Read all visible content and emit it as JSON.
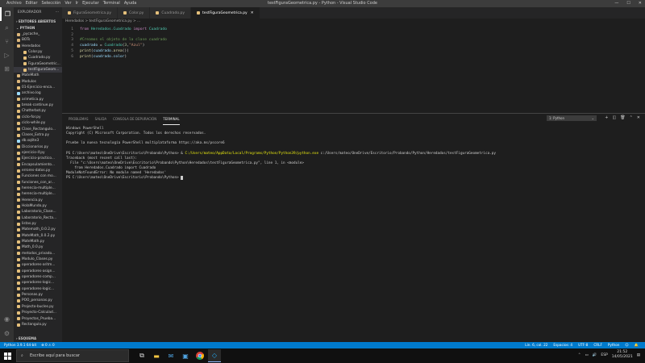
{
  "titlebar": {
    "menu": [
      "Archivo",
      "Editar",
      "Selección",
      "Ver",
      "Ir",
      "Ejecutar",
      "Terminal",
      "Ayuda"
    ],
    "title": "testFiguraGeometrica.py - Python - Visual Studio Code"
  },
  "sidebar": {
    "header": "EXPLORADOR",
    "open_editors": "EDITORES ABIERTOS",
    "root": "PYTHON",
    "items": [
      {
        "label": "_pycache_",
        "color": "#dcb67a",
        "indent": 4,
        "sel": false
      },
      {
        "label": "BOTs",
        "color": "#dcb67a",
        "indent": 4,
        "sel": false
      },
      {
        "label": "Heredados",
        "color": "#dcb67a",
        "indent": 4,
        "sel": false
      },
      {
        "label": "Color.py",
        "color": "#e5c07b",
        "indent": 12,
        "sel": false
      },
      {
        "label": "Cuadrado.py",
        "color": "#e5c07b",
        "indent": 12,
        "sel": false
      },
      {
        "label": "FiguraGeometric...",
        "color": "#e5c07b",
        "indent": 12,
        "sel": false
      },
      {
        "label": "testFiguraGeom...",
        "color": "#e5c07b",
        "indent": 12,
        "sel": true
      },
      {
        "label": "MateMath",
        "color": "#dcb67a",
        "indent": 4,
        "sel": false
      },
      {
        "label": "Modulos",
        "color": "#dcb67a",
        "indent": 4,
        "sel": false
      },
      {
        "label": "01-Ejercicio-enca...",
        "color": "#e5c07b",
        "indent": 4,
        "sel": false
      },
      {
        "label": "archivo.log",
        "color": "#9cdcfe",
        "indent": 4,
        "sel": false
      },
      {
        "label": "arimetica.py",
        "color": "#e5c07b",
        "indent": 4,
        "sel": false
      },
      {
        "label": "break-continue.py",
        "color": "#e5c07b",
        "indent": 4,
        "sel": false
      },
      {
        "label": "Chatterbot.py",
        "color": "#e5c07b",
        "indent": 4,
        "sel": false
      },
      {
        "label": "ciclo-for.py",
        "color": "#e5c07b",
        "indent": 4,
        "sel": false
      },
      {
        "label": "ciclo-while.py",
        "color": "#e5c07b",
        "indent": 4,
        "sel": false
      },
      {
        "label": "Clase_Rectangulo...",
        "color": "#e5c07b",
        "indent": 4,
        "sel": false
      },
      {
        "label": "Clases_Extra.py",
        "color": "#e5c07b",
        "indent": 4,
        "sel": false
      },
      {
        "label": "db.sqlite3",
        "color": "#9cdcfe",
        "indent": 4,
        "sel": false
      },
      {
        "label": "Diccionarios.py",
        "color": "#e5c07b",
        "indent": 4,
        "sel": false
      },
      {
        "label": "ejercicio-if.py",
        "color": "#e5c07b",
        "indent": 4,
        "sel": false
      },
      {
        "label": "Ejercicio-practico...",
        "color": "#e5c07b",
        "indent": 4,
        "sel": false
      },
      {
        "label": "Encapsulamiento...",
        "color": "#e5c07b",
        "indent": 4,
        "sel": false
      },
      {
        "label": "errores-datos.py",
        "color": "#e5c07b",
        "indent": 4,
        "sel": false
      },
      {
        "label": "Funciones con mo...",
        "color": "#e5c07b",
        "indent": 4,
        "sel": false
      },
      {
        "label": "funciones_con_ar...",
        "color": "#e5c07b",
        "indent": 4,
        "sel": false
      },
      {
        "label": "herencia-multiple...",
        "color": "#e5c07b",
        "indent": 4,
        "sel": false
      },
      {
        "label": "herencia-multiple...",
        "color": "#e5c07b",
        "indent": 4,
        "sel": false
      },
      {
        "label": "Herencia.py",
        "color": "#e5c07b",
        "indent": 4,
        "sel": false
      },
      {
        "label": "HolaMundo.py",
        "color": "#e5c07b",
        "indent": 4,
        "sel": false
      },
      {
        "label": "Laboratorio_Clase...",
        "color": "#e5c07b",
        "indent": 4,
        "sel": false
      },
      {
        "label": "Laboratorio_Recta...",
        "color": "#e5c07b",
        "indent": 4,
        "sel": false
      },
      {
        "label": "listas.py",
        "color": "#e5c07b",
        "indent": 4,
        "sel": false
      },
      {
        "label": "Matemath_0.0.2.py",
        "color": "#e5c07b",
        "indent": 4,
        "sel": false
      },
      {
        "label": "MateMath_0.0.2.py",
        "color": "#e5c07b",
        "indent": 4,
        "sel": false
      },
      {
        "label": "MateMath.py",
        "color": "#e5c07b",
        "indent": 4,
        "sel": false
      },
      {
        "label": "Math_0.0.py",
        "color": "#e5c07b",
        "indent": 4,
        "sel": false
      },
      {
        "label": "metodos_privado...",
        "color": "#e5c07b",
        "indent": 4,
        "sel": false
      },
      {
        "label": "Modulo_Clases.py",
        "color": "#e5c07b",
        "indent": 4,
        "sel": false
      },
      {
        "label": "operadores-aritm...",
        "color": "#e5c07b",
        "indent": 4,
        "sel": false
      },
      {
        "label": "operadores-asign...",
        "color": "#e5c07b",
        "indent": 4,
        "sel": false
      },
      {
        "label": "operadores-comp...",
        "color": "#e5c07b",
        "indent": 4,
        "sel": false
      },
      {
        "label": "operadores-logic...",
        "color": "#e5c07b",
        "indent": 4,
        "sel": false
      },
      {
        "label": "operadores-logic...",
        "color": "#e5c07b",
        "indent": 4,
        "sel": false
      },
      {
        "label": "Personas.py",
        "color": "#e5c07b",
        "indent": 4,
        "sel": false
      },
      {
        "label": "POO_personas.py",
        "color": "#e5c07b",
        "indent": 4,
        "sel": false
      },
      {
        "label": "Projecto-bucles.py",
        "color": "#e5c07b",
        "indent": 4,
        "sel": false
      },
      {
        "label": "Proyecto-Calculad...",
        "color": "#e5c07b",
        "indent": 4,
        "sel": false
      },
      {
        "label": "Proyectos_Prueba...",
        "color": "#e5c07b",
        "indent": 4,
        "sel": false
      },
      {
        "label": "Rectangulo.py",
        "color": "#e5c07b",
        "indent": 4,
        "sel": false
      }
    ],
    "footer": "ESQUEMA"
  },
  "tabs": [
    {
      "label": "FiguraGeometrica.py",
      "active": false
    },
    {
      "label": "Color.py",
      "active": false
    },
    {
      "label": "Cuadrado.py",
      "active": false
    },
    {
      "label": "testFiguraGeometrica.py",
      "active": true
    }
  ],
  "breadcrumb": "Heredados > testFiguraGeometrica.py > ...",
  "code": [
    {
      "n": "1",
      "html": "<span class='kw'>from</span> <span class='cls'>Heredados.Cuadrado</span> <span class='kw'>import</span> <span class='cls'>Cuadrado</span>"
    },
    {
      "n": "2",
      "html": ""
    },
    {
      "n": "3",
      "html": "<span class='cmt'>#Creamos el objeto de la clase cuadrado</span>"
    },
    {
      "n": "4",
      "html": "<span class='var'>cuadrado</span> <span class='pl'>=</span> <span class='cls'>Cuadrado</span><span class='pl'>(</span><span class='num'>3</span><span class='pl'>,</span><span class='str'>\"Azul\"</span><span class='pl'>)</span>"
    },
    {
      "n": "5",
      "html": "<span class='fn'>print</span><span class='pl'>(</span><span class='var'>cuadrado</span><span class='pl'>.</span><span class='fn'>area</span><span class='pl'>())</span>"
    },
    {
      "n": "6",
      "html": "<span class='fn'>print</span><span class='pl'>(</span><span class='var'>cuadrado</span><span class='pl'>.</span><span class='var'>color</span><span class='pl'>)</span>"
    }
  ],
  "panel": {
    "tabs": [
      "PROBLEMAS",
      "SALIDA",
      "CONSOLA DE DEPURACIÓN",
      "TERMINAL"
    ],
    "active": "TERMINAL",
    "terminal_select": "1: Python"
  },
  "terminal": [
    {
      "html": "Windows PowerShell"
    },
    {
      "html": "Copyright (C) Microsoft Corporation. Todos los derechos reservados."
    },
    {
      "html": ""
    },
    {
      "html": "Pruebe la nueva tecnología PowerShell multiplataforma https://aka.ms/pscore6"
    },
    {
      "html": ""
    },
    {
      "html": "PS C:\\Users\\mateo\\OneDrive\\Escritorio\\Probando\\Python> &amp; <span class='ty'>C:/Users/mateo/AppData/Local/Programs/Python/Python39/python.exe</span> c:/Users/mateo/OneDrive/Escritorio/Probando/Python/Heredados/testFiguraGeometrica.py"
    },
    {
      "html": "Traceback (most recent call last):"
    },
    {
      "html": "  File \"c:\\Users\\mateo\\OneDrive\\Escritorio\\Probando\\Python\\Heredados\\testFiguraGeometrica.py\", line 1, in &lt;module&gt;"
    },
    {
      "html": "    from Heredados.Cuadrado import Cuadrado"
    },
    {
      "html": "ModuleNotFoundError: No module named 'Heredados'"
    },
    {
      "html": "PS C:\\Users\\mateo\\OneDrive\\Escritorio\\Probando\\Python> <span style='background:#ccc'> </span>"
    }
  ],
  "status": {
    "left": [
      "Python 3.9.1 64-bit",
      "⊗ 0 ⚠ 0"
    ],
    "right": [
      "Lín. 6, col. 22",
      "Espacios: 4",
      "UTF-8",
      "CRLF",
      "Python",
      "☺",
      "🔔"
    ]
  },
  "taskbar": {
    "search_placeholder": "Escribe aquí para buscar",
    "time": "21:52",
    "date": "14/05/2021",
    "lang": "ESP"
  },
  "colors": {
    "accent": "#007acc",
    "selected": "#37373d",
    "python_icon": "#e5c07b",
    "folder": "#dcb67a"
  }
}
